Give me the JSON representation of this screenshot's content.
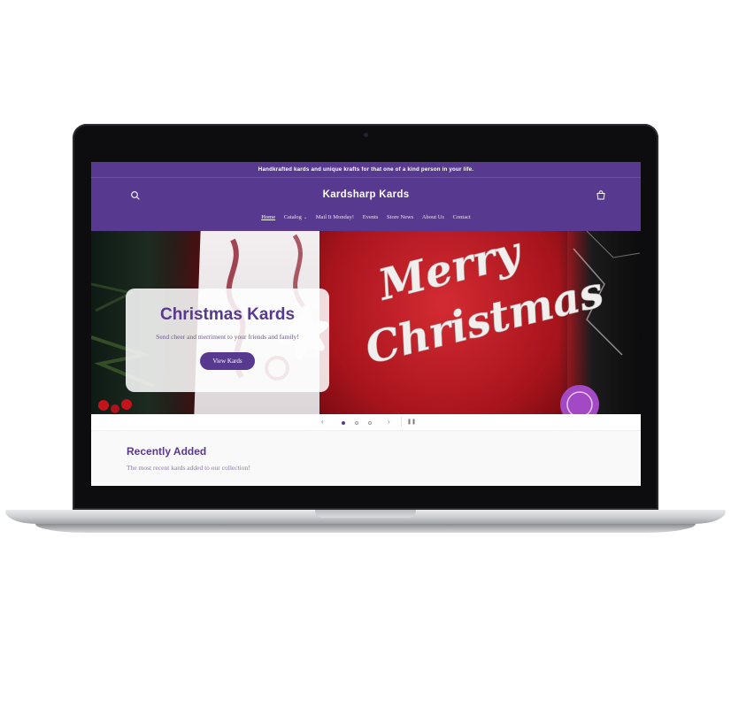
{
  "announcement": {
    "text": "Handkrafted kards and unique krafts for that one of a kind person in your life."
  },
  "header": {
    "site_title": "Kardsharp Kards",
    "search_icon": "search-icon",
    "cart_icon": "cart-icon",
    "nav": [
      {
        "label": "Home",
        "active": true
      },
      {
        "label": "Catalog",
        "has_dropdown": true
      },
      {
        "label": "Mail It Monday!"
      },
      {
        "label": "Events"
      },
      {
        "label": "Store News"
      },
      {
        "label": "About Us"
      },
      {
        "label": "Contact"
      }
    ]
  },
  "hero": {
    "heading": "Christmas Kards",
    "subtext": "Send cheer and merriment to your friends and family!",
    "button_label": "View Kards",
    "image_text_line1": "Merry",
    "image_text_line2": "Christmas"
  },
  "slider": {
    "prev_icon": "chevron-left-icon",
    "next_icon": "chevron-right-icon",
    "pause_icon": "pause-icon",
    "slide_count": 3,
    "active_slide": 1
  },
  "recent": {
    "heading": "Recently Added",
    "subtext": "The most recent kards added to our collection!"
  },
  "colors": {
    "brand_purple": "#57398f",
    "screen_background": "#f9f9fa",
    "laptop_bezel": "#0d0d0f"
  }
}
